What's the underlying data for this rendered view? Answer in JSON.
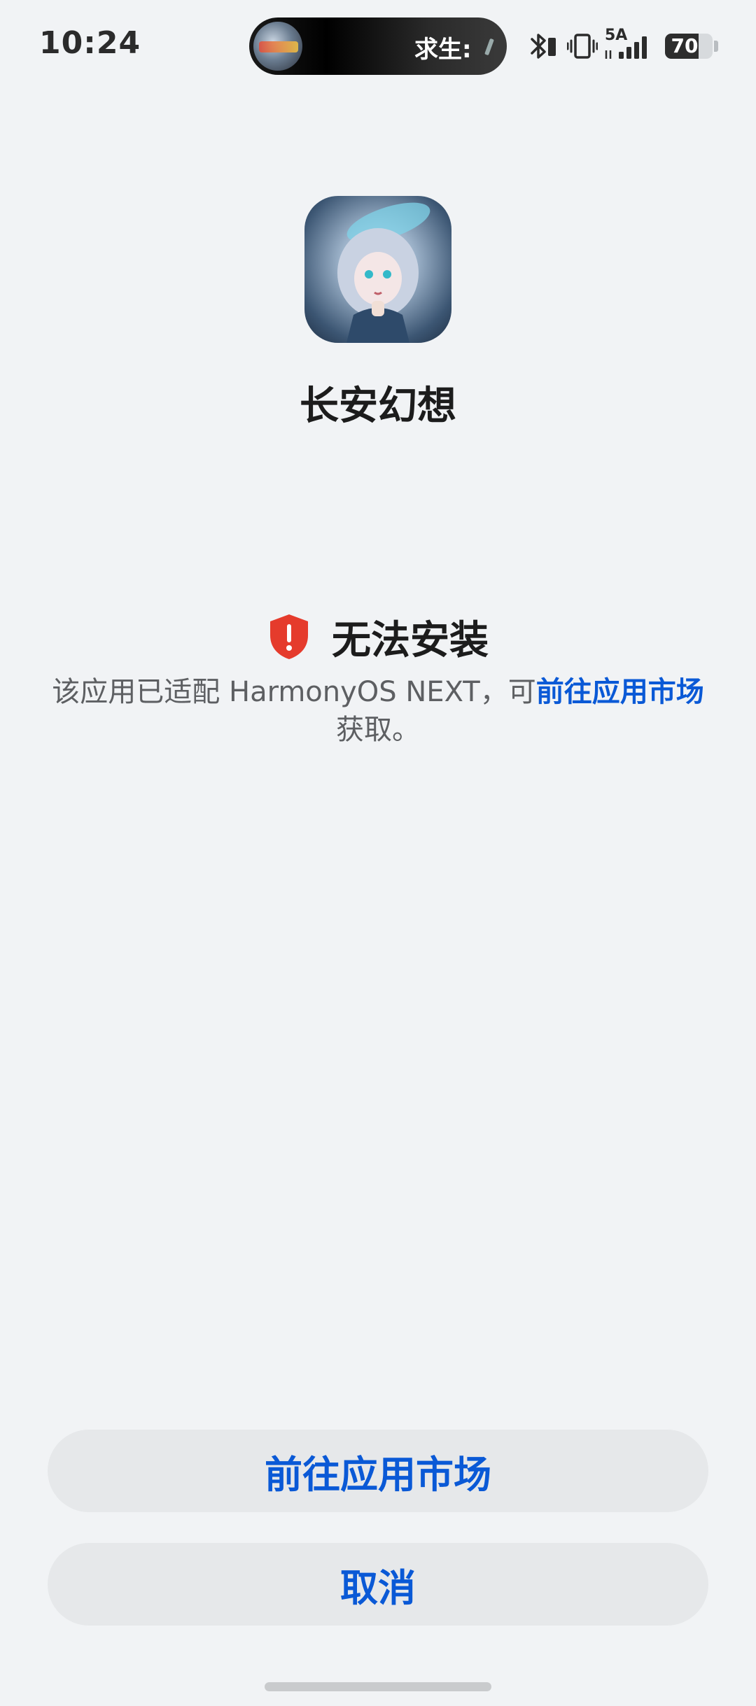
{
  "status_bar": {
    "time": "10:24",
    "capsule_text": "求生:",
    "network_label": "5A",
    "battery_level": "70",
    "battery_fraction": 0.7
  },
  "app": {
    "name": "长安幻想",
    "icon": "app-icon"
  },
  "warning": {
    "title": "无法安装",
    "icon": "shield-alert-icon",
    "icon_color": "#e53b2c",
    "desc_prefix": "该应用已适配 HarmonyOS NEXT，可",
    "desc_link": "前往应用市场",
    "desc_suffix": "获取。"
  },
  "buttons": {
    "primary_label": "前往应用市场",
    "cancel_label": "取消"
  },
  "colors": {
    "accent": "#0a59d6",
    "background": "#f1f3f5",
    "button_bg": "#e6e8ea"
  }
}
